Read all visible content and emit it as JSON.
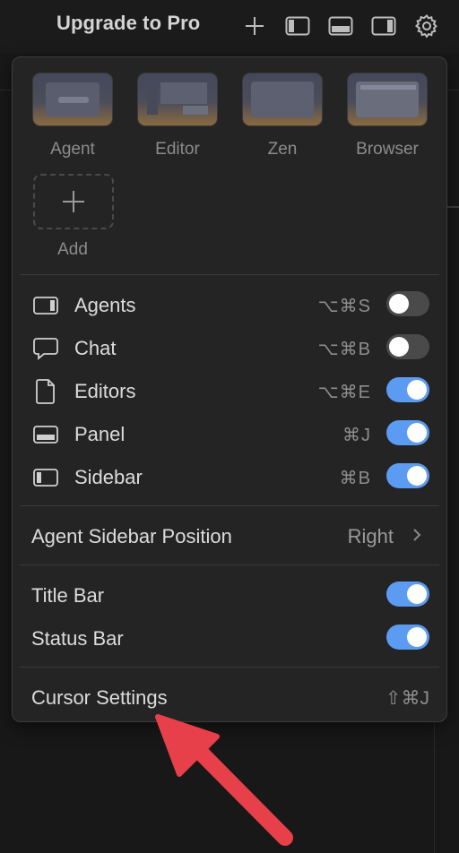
{
  "topbar": {
    "upgrade_label": "Upgrade to Pro",
    "icons": [
      "plus-icon",
      "toggle-sidebar-left-icon",
      "toggle-panel-icon",
      "toggle-sidebar-right-icon",
      "gear-icon"
    ]
  },
  "layouts": {
    "items": [
      {
        "label": "Agent",
        "icon": "agent-layout-thumbnail"
      },
      {
        "label": "Editor",
        "icon": "editor-layout-thumbnail"
      },
      {
        "label": "Zen",
        "icon": "zen-layout-thumbnail"
      },
      {
        "label": "Browser",
        "icon": "browser-layout-thumbnail"
      }
    ],
    "add_label": "Add"
  },
  "toggles": [
    {
      "label": "Agents",
      "shortcut": "⌥⌘S",
      "on": false,
      "icon": "agents-panel-icon"
    },
    {
      "label": "Chat",
      "shortcut": "⌥⌘B",
      "on": false,
      "icon": "chat-icon"
    },
    {
      "label": "Editors",
      "shortcut": "⌥⌘E",
      "on": true,
      "icon": "file-icon"
    },
    {
      "label": "Panel",
      "shortcut": "⌘J",
      "on": true,
      "icon": "panel-icon"
    },
    {
      "label": "Sidebar",
      "shortcut": "⌘B",
      "on": true,
      "icon": "sidebar-icon"
    }
  ],
  "agent_sidebar": {
    "label": "Agent Sidebar Position",
    "value": "Right"
  },
  "bars": [
    {
      "label": "Title Bar",
      "on": true
    },
    {
      "label": "Status Bar",
      "on": true
    }
  ],
  "footer": {
    "label": "Cursor Settings",
    "shortcut": "⇧⌘J"
  },
  "colors": {
    "toggle_on": "#5b9cf2",
    "toggle_off": "#4a4a4a",
    "arrow": "#e8404a"
  }
}
